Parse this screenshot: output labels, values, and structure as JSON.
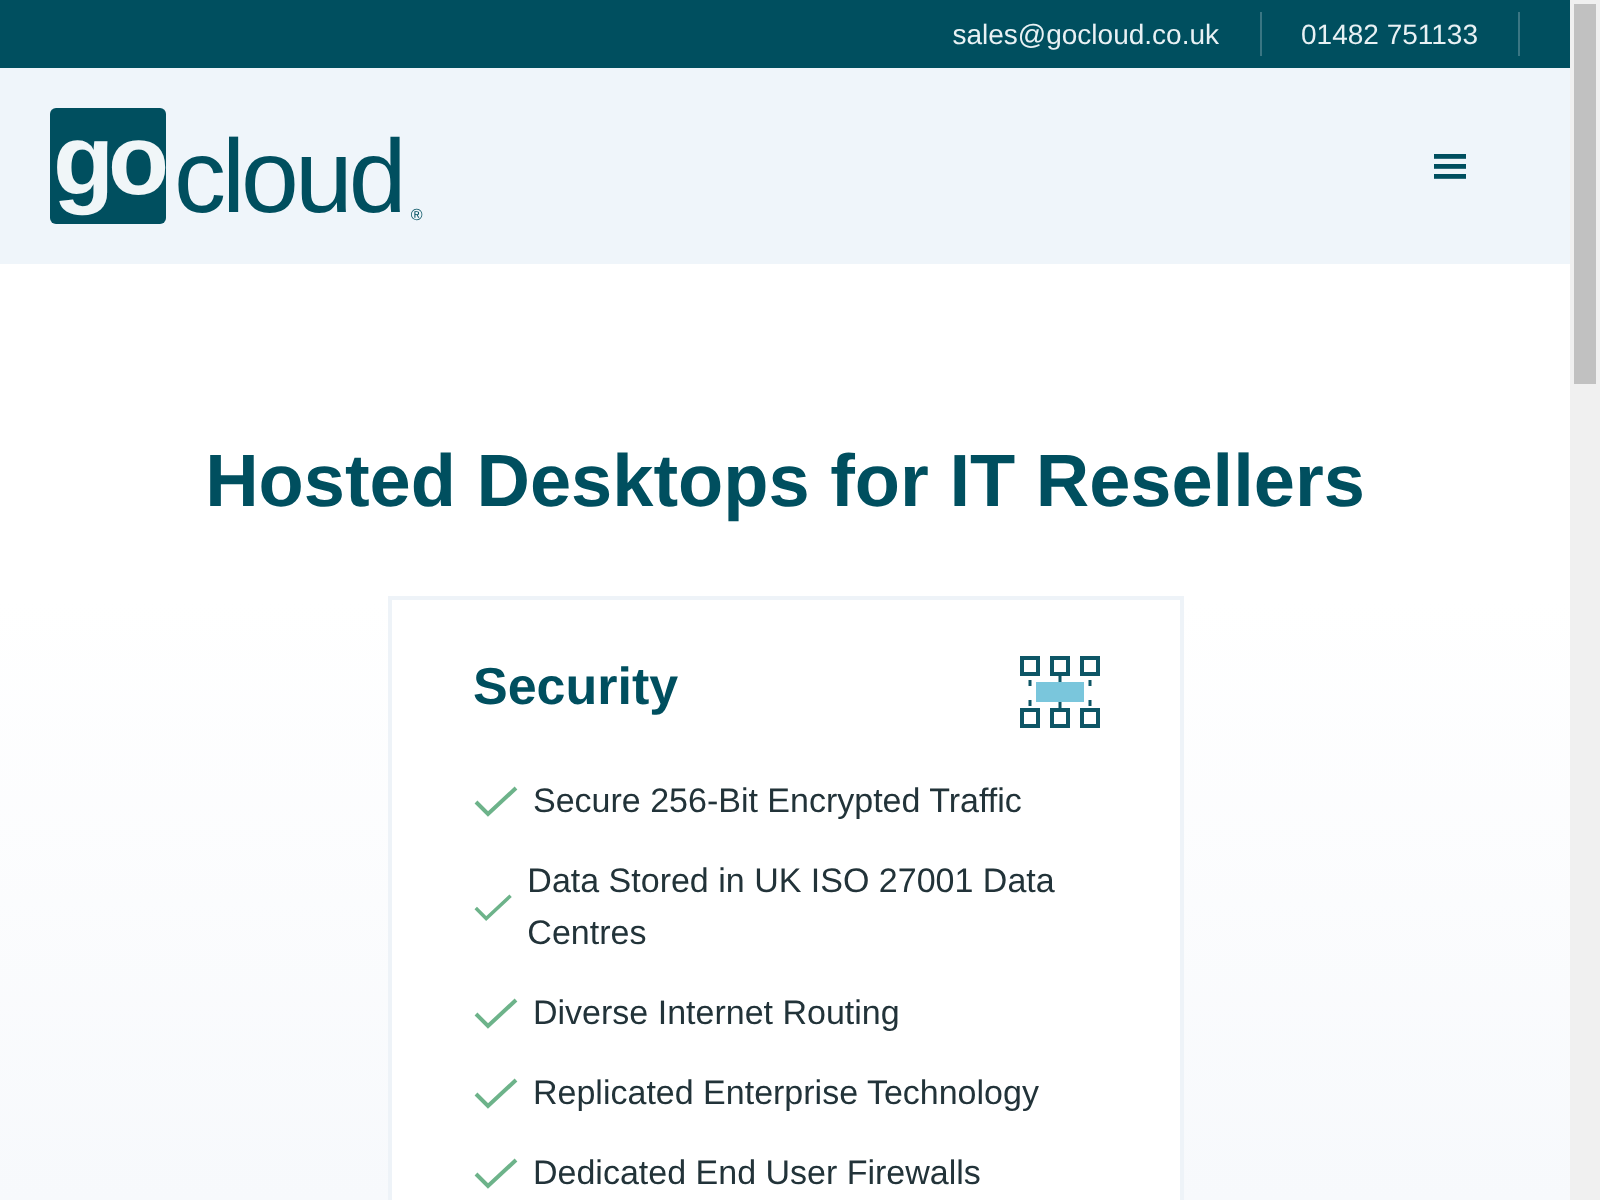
{
  "top_bar": {
    "email": "sales@gocloud.co.uk",
    "phone": "01482 751133"
  },
  "logo": {
    "badge": "go",
    "word": "cloud",
    "mark": "®"
  },
  "heading": "Hosted Desktops for IT Resellers",
  "card": {
    "title": "Security",
    "features": [
      {
        "text": "Secure 256-Bit Encrypted Traffic"
      },
      {
        "text": "Data Stored in UK ISO 27001 Data Centres"
      },
      {
        "text": "Diverse Internet Routing"
      },
      {
        "text": "Replicated Enterprise Technology"
      },
      {
        "text": "Dedicated End User Firewalls"
      }
    ]
  }
}
